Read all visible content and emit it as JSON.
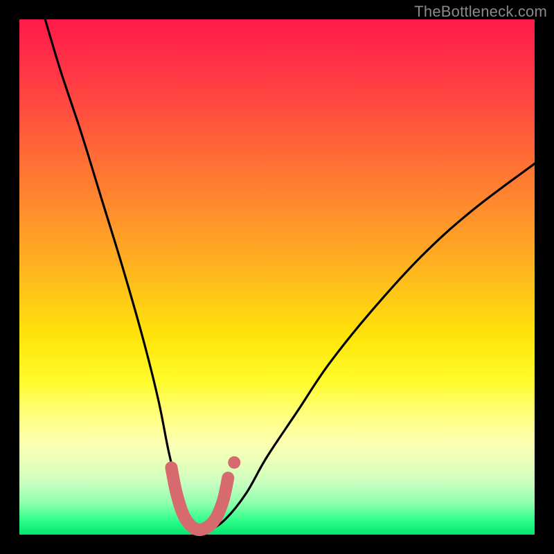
{
  "watermark": "TheBottleneck.com",
  "chart_data": {
    "type": "line",
    "title": "",
    "xlabel": "",
    "ylabel": "",
    "xlim": [
      0,
      100
    ],
    "ylim": [
      0,
      100
    ],
    "grid": false,
    "legend": false,
    "series": [
      {
        "name": "bottleneck-curve",
        "color": "#000000",
        "x": [
          5,
          8,
          12,
          16,
          20,
          24,
          27,
          29,
          31,
          33,
          35,
          37,
          40,
          44,
          48,
          54,
          60,
          68,
          78,
          88,
          100
        ],
        "y": [
          100,
          90,
          78,
          65,
          52,
          38,
          26,
          16,
          8,
          3,
          1,
          1,
          3,
          8,
          15,
          24,
          33,
          43,
          54,
          63,
          72
        ]
      }
    ],
    "highlight": {
      "name": "optimal-zone",
      "color": "#d76a6f",
      "x": [
        29.5,
        30.5,
        32,
        34,
        36,
        38,
        39.5,
        40.5
      ],
      "y": [
        13,
        8,
        3.5,
        1.2,
        1.2,
        3,
        6.5,
        11
      ]
    }
  },
  "colors": {
    "background_black": "#000000",
    "curve": "#000000",
    "highlight": "#d76a6f",
    "watermark": "#8a8a8a"
  }
}
